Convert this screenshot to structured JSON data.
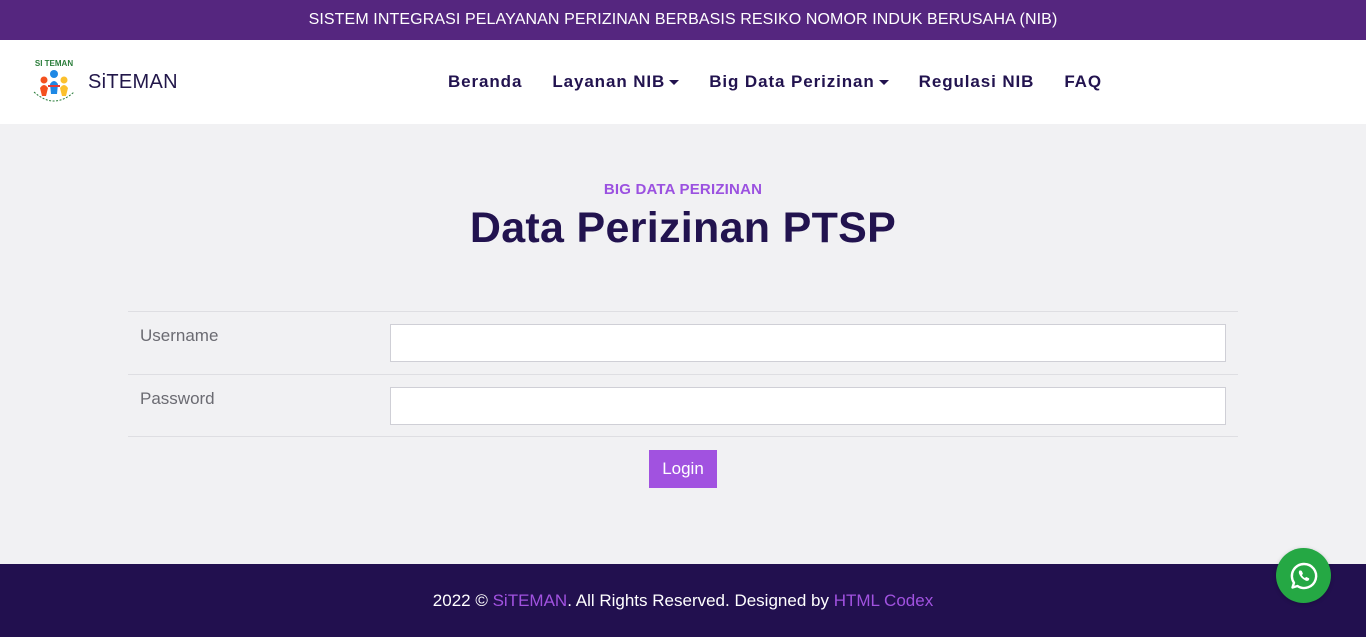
{
  "topbar": {
    "text": "SISTEM INTEGRASI PELAYANAN PERIZINAN BERBASIS RESIKO NOMOR INDUK BERUSAHA (NIB)"
  },
  "brand": {
    "logo_text": "Si TEMAN",
    "name": "SiTEMAN"
  },
  "nav": {
    "items": [
      {
        "label": "Beranda",
        "dropdown": false
      },
      {
        "label": "Layanan NIB",
        "dropdown": true
      },
      {
        "label": "Big Data Perizinan",
        "dropdown": true
      },
      {
        "label": "Regulasi NIB",
        "dropdown": false
      },
      {
        "label": "FAQ",
        "dropdown": false
      }
    ]
  },
  "main": {
    "eyebrow": "BIG DATA PERIZINAN",
    "title": "Data Perizinan PTSP"
  },
  "form": {
    "username_label": "Username",
    "username_value": "",
    "password_label": "Password",
    "password_value": "",
    "login_label": "Login"
  },
  "footer": {
    "year": "2022 © ",
    "brand_link": "SiTEMAN",
    "rights": ". All Rights Reserved. Designed by ",
    "designer_link": "HTML Codex"
  },
  "colors": {
    "topbar": "#55267f",
    "nav_text": "#22134f",
    "accent": "#a152e0",
    "footer": "#22104f",
    "whatsapp": "#25a844"
  },
  "icons": {
    "whatsapp": "whatsapp-icon",
    "caret": "caret-down-icon"
  }
}
